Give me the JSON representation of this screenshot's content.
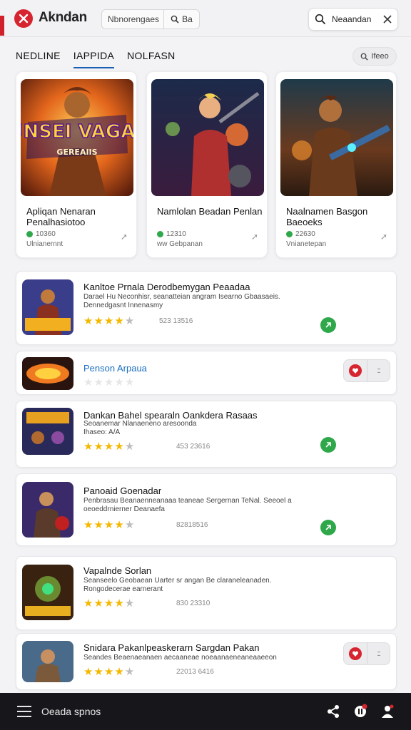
{
  "header": {
    "app_title": "Akndan",
    "search_text": "Nbnorengaes",
    "search_button": "Ba",
    "search_pill_text": "Neaandan",
    "accent_color": "#d0202c"
  },
  "tabs": [
    {
      "label": "NEDLINE",
      "active": false
    },
    {
      "label": "IAPPIDA",
      "active": true
    },
    {
      "label": "NOLFASN",
      "active": false
    }
  ],
  "filter_label": "Ifeeo",
  "featured": [
    {
      "title": "Apliqan Nenaran Penalhasiotoo",
      "rating": "10360",
      "subtitle": "Ulnianernnt",
      "art_text": "PAUNSEI VAGADIR",
      "art_sub": "GEREAIIS"
    },
    {
      "title": "Namlolan Beadan Penlan",
      "rating": "12310",
      "subtitle": "ww Gebpanan"
    },
    {
      "title": "Naalnamen Basgon Baeoeks",
      "rating": "22630",
      "subtitle": "Vnianetepan"
    }
  ],
  "rows": [
    {
      "title": "Kanltoe Prnala Derodbemygan Peaadaa",
      "desc": "Darael Hu Neconhisr, seanatteian angram Isearno Gbaasaeis. Dennedgasnt Innenasmy",
      "rating": 3.5,
      "count": "523 13516",
      "action": "download"
    },
    {
      "title": "Penson Arpaua",
      "desc": "",
      "rating": 0,
      "count": "",
      "action": "favorite",
      "more": "::"
    },
    {
      "title": "Dankan Bahel spearaln Oankdera Rasaas",
      "desc": "Seoanemar Nlanaeneno aresoonda Ihaseo: A/A",
      "rating": 3.5,
      "count": "453 23616",
      "action": "download"
    },
    {
      "title": "Panoaid Goenadar",
      "desc": "Penbrasau Beanaenneanaaa teaneae Sergernan TeNal. Seeoel a oeoeddrnierner Deanaefa",
      "rating": 4.5,
      "count": "82818516",
      "action": "download"
    },
    {
      "title": "Vapalnde Sorlan",
      "desc": "Seanseelo Geobaean Uarter sr angan Be claraneleanaden. Rongodecerae earnerant",
      "rating": 3.5,
      "count": "830 23310",
      "action": "none"
    },
    {
      "title": "Snidara Pakanlpeaskerarn Sargdan Pakan",
      "desc": "Seandes Beaenaeanaen aecaaneae noeaanaeneaneaaeeon",
      "rating": 4.5,
      "count": "22013 6416",
      "action": "favorite",
      "more": "::"
    }
  ],
  "bottom": {
    "menu_label": "Oeada spnos"
  }
}
